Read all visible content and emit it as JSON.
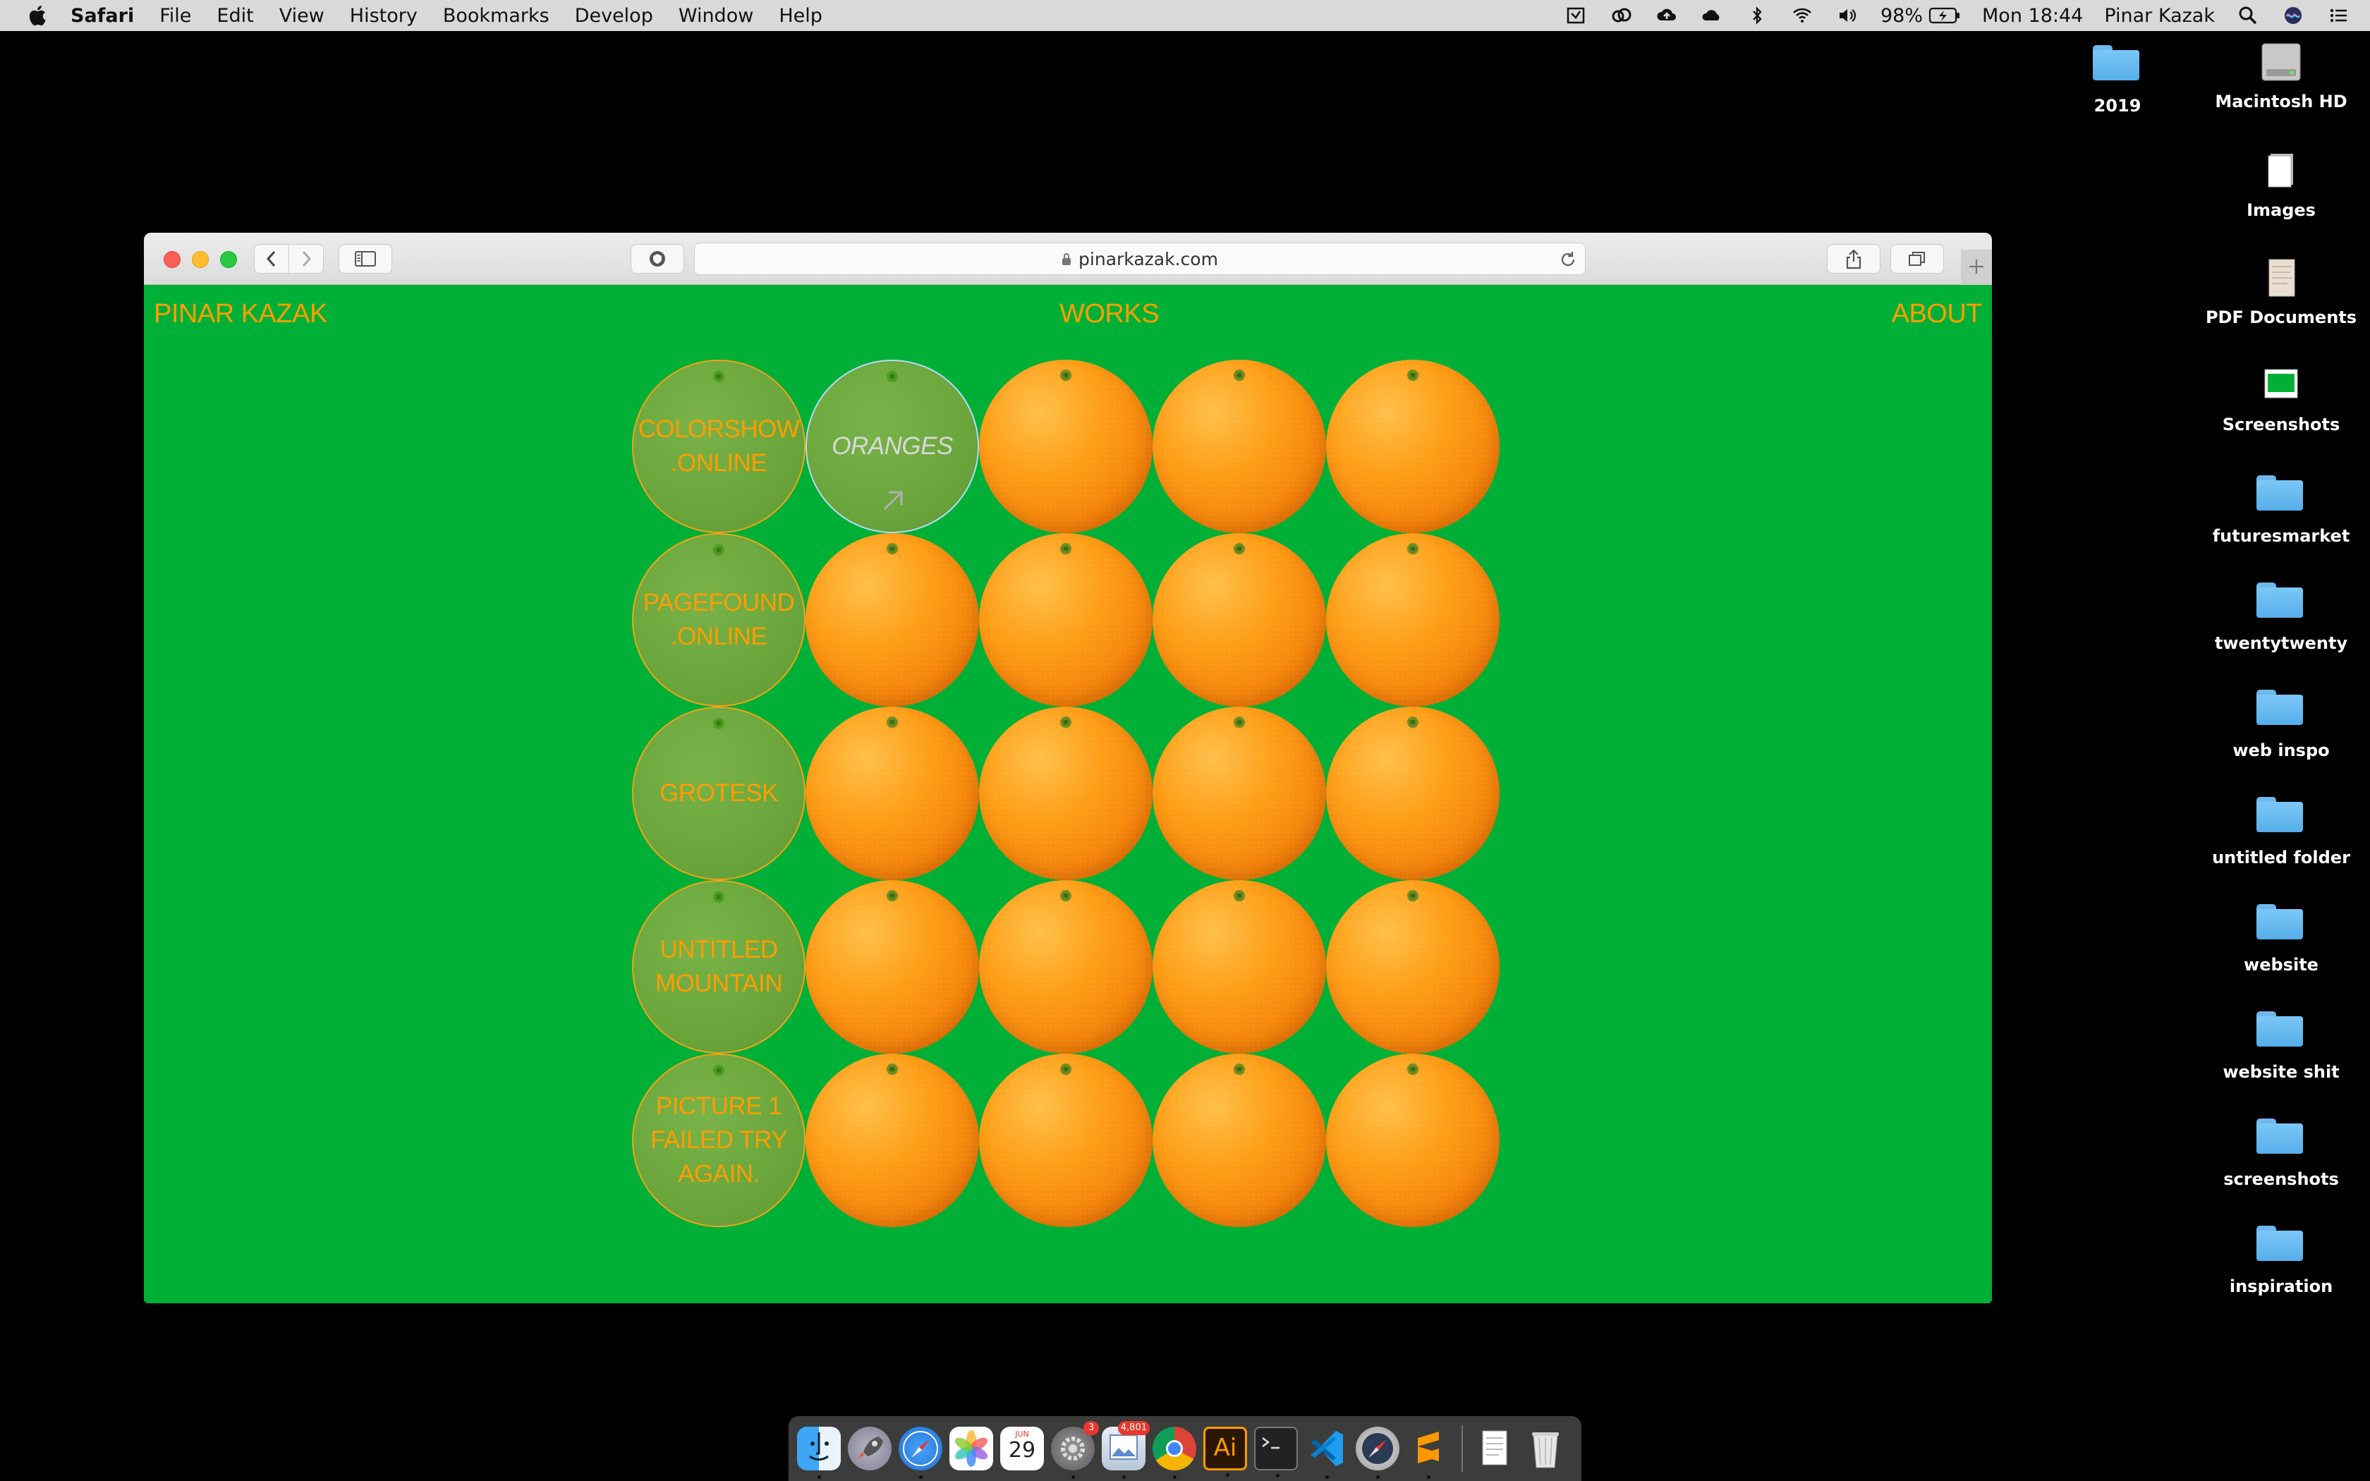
{
  "menubar": {
    "app_name": "Safari",
    "items": [
      "File",
      "Edit",
      "View",
      "History",
      "Bookmarks",
      "Develop",
      "Window",
      "Help"
    ],
    "battery": "98%",
    "clock": "Mon 18:44",
    "user": "Pinar Kazak"
  },
  "desktop": {
    "items": [
      {
        "label": "2019",
        "icon": "folder-icon"
      },
      {
        "label": "Macintosh HD",
        "icon": "hard-drive-icon"
      },
      {
        "label": "Images",
        "icon": "document-icon"
      },
      {
        "label": "PDF Documents",
        "icon": "document-icon"
      },
      {
        "label": "Screenshots",
        "icon": "screenshot-icon"
      },
      {
        "label": "futuresmarket",
        "icon": "folder-icon"
      },
      {
        "label": "twentytwenty",
        "icon": "folder-icon"
      },
      {
        "label": "web inspo",
        "icon": "folder-icon"
      },
      {
        "label": "untitled folder",
        "icon": "folder-icon"
      },
      {
        "label": "website",
        "icon": "folder-icon"
      },
      {
        "label": "website shit",
        "icon": "folder-icon"
      },
      {
        "label": "screenshots",
        "icon": "folder-icon"
      },
      {
        "label": "inspiration",
        "icon": "folder-icon"
      }
    ]
  },
  "browser": {
    "url": "pinarkazak.com"
  },
  "site": {
    "nav": {
      "home": "PINAR KAZAK",
      "works": "WORKS",
      "about": "ABOUT"
    },
    "works": [
      {
        "line1": "COLORSHOW",
        "line2": ".ONLINE",
        "line3": ""
      },
      {
        "line1": "ORANGES",
        "line2": "",
        "line3": ""
      },
      {
        "line1": "PAGEFOUND",
        "line2": ".ONLINE",
        "line3": ""
      },
      {
        "line1": "GROTESK",
        "line2": "",
        "line3": ""
      },
      {
        "line1": "UNTITLED",
        "line2": "MOUNTAIN",
        "line3": ""
      },
      {
        "line1": "PICTURE 1",
        "line2": "FAILED TRY",
        "line3": "AGAIN."
      }
    ]
  },
  "dock": {
    "apps": [
      "finder",
      "launchpad",
      "safari",
      "photos",
      "calendar",
      "system-preferences",
      "preview",
      "chrome",
      "illustrator",
      "terminal",
      "vscode",
      "compass",
      "sublime-text"
    ],
    "calendar_day": "29",
    "calendar_month": "JUN",
    "sysprefs_badge": "3",
    "preview_badge": "4,801",
    "illustrator_label": "Ai"
  },
  "colors": {
    "page_bg": "#00b036",
    "accent_text": "#ff9d00",
    "orange": "#f3840a"
  }
}
